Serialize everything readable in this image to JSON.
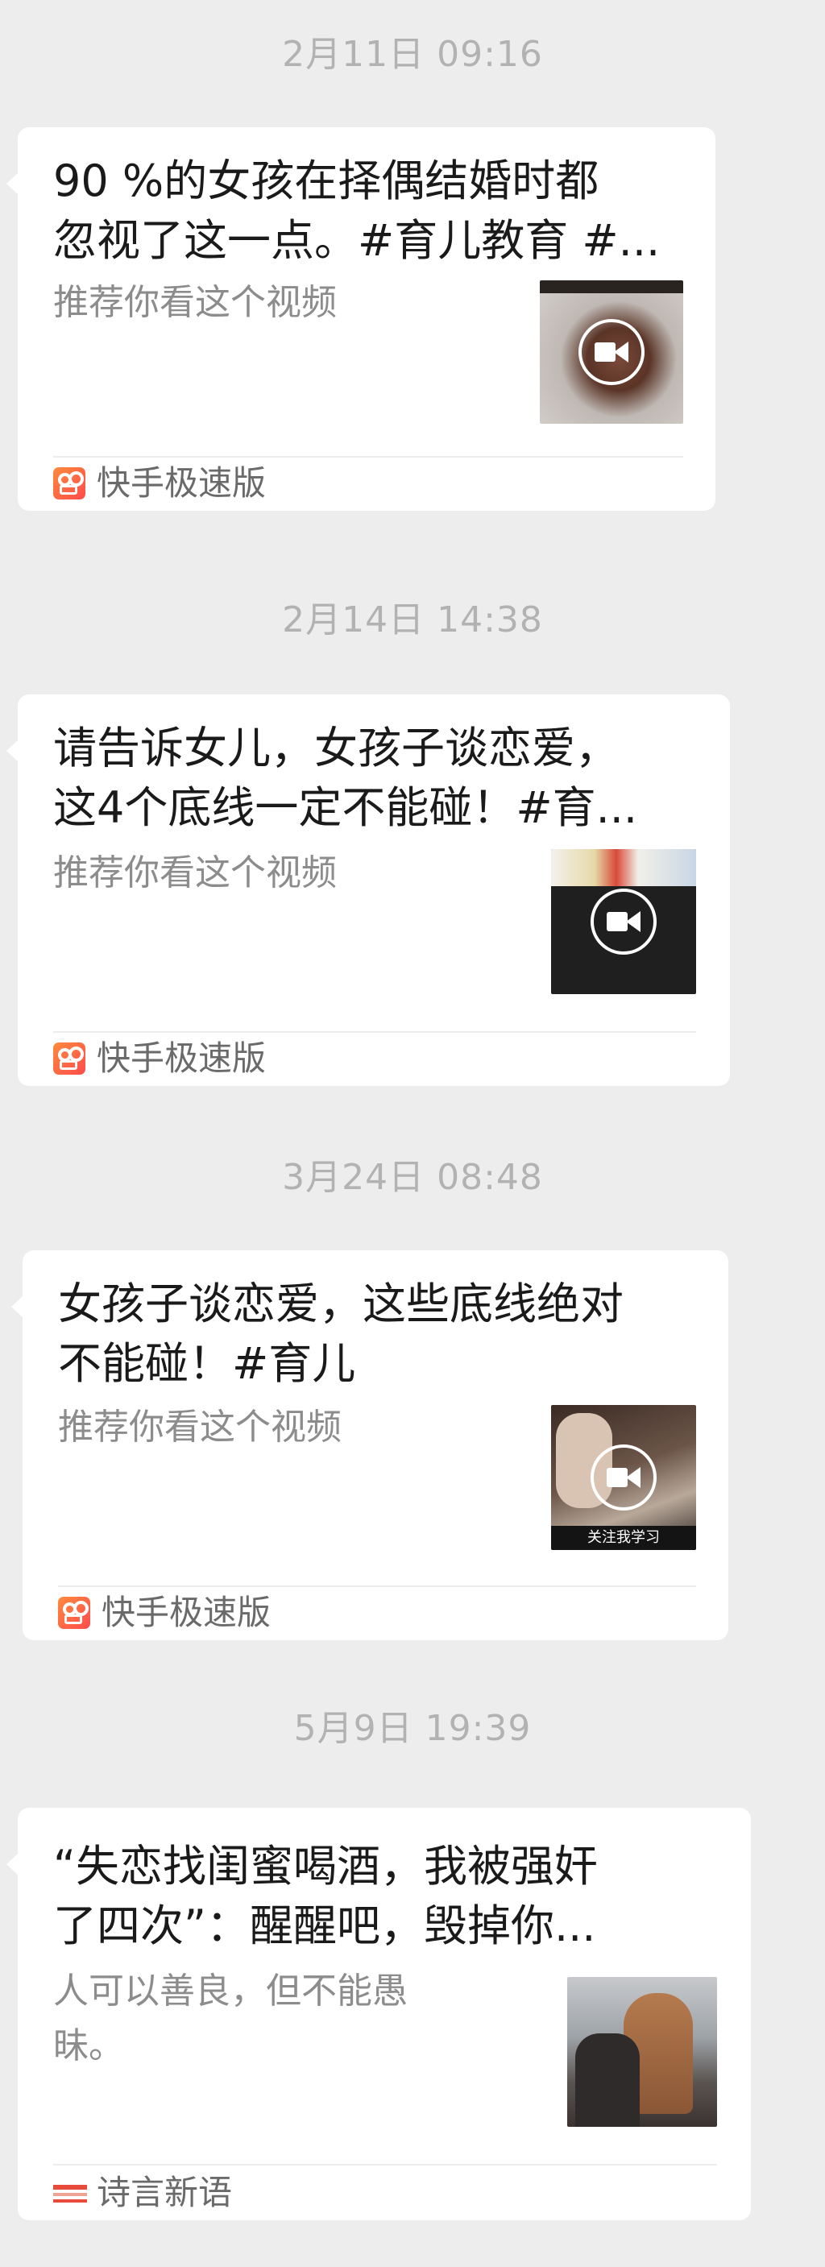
{
  "colors": {
    "background": "#ededed",
    "card": "#ffffff",
    "timestamp": "#b2b2b2",
    "title": "#1a1a1a",
    "description": "#8c8c8c",
    "kuaishou_brand": "#ff5a3c"
  },
  "messages": [
    {
      "timestamp": "2月11日 09:16",
      "title_line1": "90 %的女孩在择偶结婚时都",
      "title_line2": "忽视了这一点。#育儿教育 #...",
      "description_line1": "推荐你看这个视频",
      "description_line2": "",
      "thumbnail_icon": "video-camera-icon",
      "source_icon": "kuaishou-icon",
      "source_name": "快手极速版"
    },
    {
      "timestamp": "2月14日 14:38",
      "title_line1": "请告诉女儿，女孩子谈恋爱，",
      "title_line2": "这4个底线一定不能碰！#育...",
      "description_line1": "推荐你看这个视频",
      "description_line2": "",
      "thumbnail_icon": "video-camera-icon",
      "source_icon": "kuaishou-icon",
      "source_name": "快手极速版"
    },
    {
      "timestamp": "3月24日 08:48",
      "title_line1": "女孩子谈恋爱，这些底线绝对",
      "title_line2": "不能碰！#育儿",
      "description_line1": "推荐你看这个视频",
      "description_line2": "",
      "thumbnail_caption": "关注我学习",
      "thumbnail_icon": "video-camera-icon",
      "source_icon": "kuaishou-icon",
      "source_name": "快手极速版"
    },
    {
      "timestamp": "5月9日 19:39",
      "title_line1": "“失恋找闺蜜喝酒，我被强奸",
      "title_line2": "了四次”：醒醒吧，毁掉你...",
      "description_line1": "人可以善良，但不能愚",
      "description_line2": "昧。",
      "source_icon": "shiyan-xinyu-logo-icon",
      "source_name": "诗言新语"
    }
  ]
}
